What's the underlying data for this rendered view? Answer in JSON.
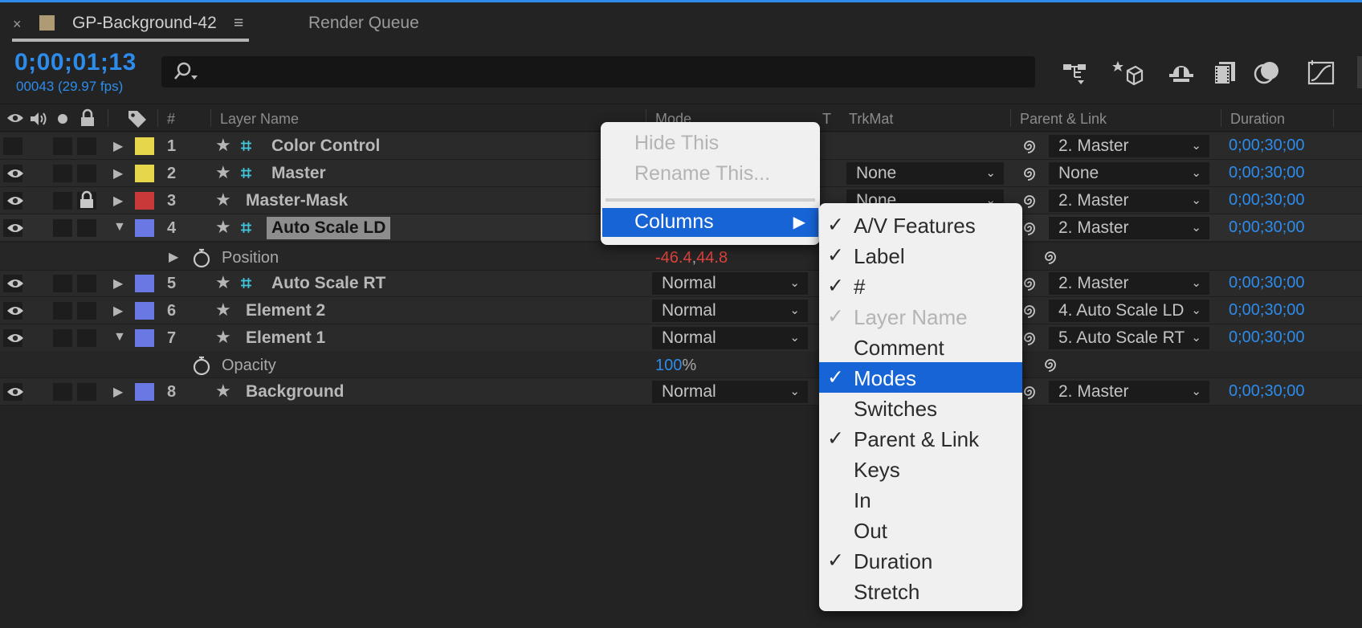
{
  "tab": {
    "close": "×",
    "title": "GP-Background-42",
    "menu": "≡",
    "render_queue": "Render Queue"
  },
  "timecode": {
    "value": "0;00;01;13",
    "frames": "00043 (29.97 fps)"
  },
  "search": {
    "placeholder": ""
  },
  "toolbar": {
    "icons": [
      "composition-flowchart-icon",
      "draft-3d-icon",
      "shy-icon",
      "frame-blending-icon",
      "motion-blur-icon",
      "graph-editor-icon"
    ]
  },
  "columns": {
    "num": "#",
    "layer_name": "Layer Name",
    "mode": "Mode",
    "t": "T",
    "trkmat": "TrkMat",
    "parent": "Parent & Link",
    "duration": "Duration"
  },
  "layers": [
    {
      "num": "1",
      "name": "Color Control",
      "label_color": "#e6d64b",
      "eye": false,
      "lock": false,
      "mode": "",
      "trkmat": "",
      "parent": "2. Master",
      "duration": "0;00;30;00"
    },
    {
      "num": "2",
      "name": "Master",
      "label_color": "#e6d64b",
      "eye": true,
      "lock": false,
      "mode": "",
      "trkmat": "None",
      "parent": "None",
      "duration": "0;00;30;00"
    },
    {
      "num": "3",
      "name": "Master-Mask",
      "label_color": "#c9393a",
      "eye": true,
      "lock": true,
      "mode": "",
      "trkmat": "None",
      "parent": "2. Master",
      "duration": "0;00;30;00"
    },
    {
      "num": "4",
      "name": "Auto Scale LD",
      "label_color": "#6a78e3",
      "eye": true,
      "lock": false,
      "mode": "",
      "trkmat": "",
      "parent": "2. Master",
      "duration": "0;00;30;00"
    },
    {
      "num": "5",
      "name": "Auto Scale RT",
      "label_color": "#6a78e3",
      "eye": true,
      "lock": false,
      "mode": "Normal",
      "trkmat": "",
      "parent": "2. Master",
      "duration": "0;00;30;00"
    },
    {
      "num": "6",
      "name": "Element 2",
      "label_color": "#6a78e3",
      "eye": true,
      "lock": false,
      "mode": "Normal",
      "trkmat": "",
      "parent": "4. Auto Scale LD",
      "duration": "0;00;30;00"
    },
    {
      "num": "7",
      "name": "Element 1",
      "label_color": "#6a78e3",
      "eye": true,
      "lock": false,
      "mode": "Normal",
      "trkmat": "",
      "parent": "5. Auto Scale RT",
      "duration": "0;00;30;00"
    },
    {
      "num": "8",
      "name": "Background",
      "label_color": "#6a78e3",
      "eye": true,
      "lock": false,
      "mode": "Normal",
      "trkmat": "",
      "parent": "2. Master",
      "duration": "0;00;30;00"
    }
  ],
  "properties": {
    "position": {
      "name": "Position",
      "x": "-46.4",
      "sep": ",",
      "y": "44.8"
    },
    "opacity": {
      "name": "Opacity",
      "value": "100",
      "unit": "%"
    }
  },
  "context_menu": {
    "hide": "Hide This",
    "rename": "Rename This...",
    "columns": "Columns",
    "arrow": "▶"
  },
  "columns_submenu": [
    {
      "label": "A/V Features",
      "checked": true,
      "disabled": false,
      "highlight": false
    },
    {
      "label": "Label",
      "checked": true,
      "disabled": false,
      "highlight": false
    },
    {
      "label": "#",
      "checked": true,
      "disabled": false,
      "highlight": false
    },
    {
      "label": "Layer Name",
      "checked": true,
      "disabled": true,
      "highlight": false
    },
    {
      "label": "Comment",
      "checked": false,
      "disabled": false,
      "highlight": false
    },
    {
      "label": "Modes",
      "checked": true,
      "disabled": false,
      "highlight": true
    },
    {
      "label": "Switches",
      "checked": false,
      "disabled": false,
      "highlight": false
    },
    {
      "label": "Parent & Link",
      "checked": true,
      "disabled": false,
      "highlight": false
    },
    {
      "label": "Keys",
      "checked": false,
      "disabled": false,
      "highlight": false
    },
    {
      "label": "In",
      "checked": false,
      "disabled": false,
      "highlight": false
    },
    {
      "label": "Out",
      "checked": false,
      "disabled": false,
      "highlight": false
    },
    {
      "label": "Duration",
      "checked": true,
      "disabled": false,
      "highlight": false
    },
    {
      "label": "Stretch",
      "checked": false,
      "disabled": false,
      "highlight": false
    }
  ],
  "glyphs": {
    "check": "✓",
    "tri_right": "▶",
    "tri_down": "▼",
    "star": "★",
    "hash": "⌗",
    "chevron": "⌄"
  }
}
